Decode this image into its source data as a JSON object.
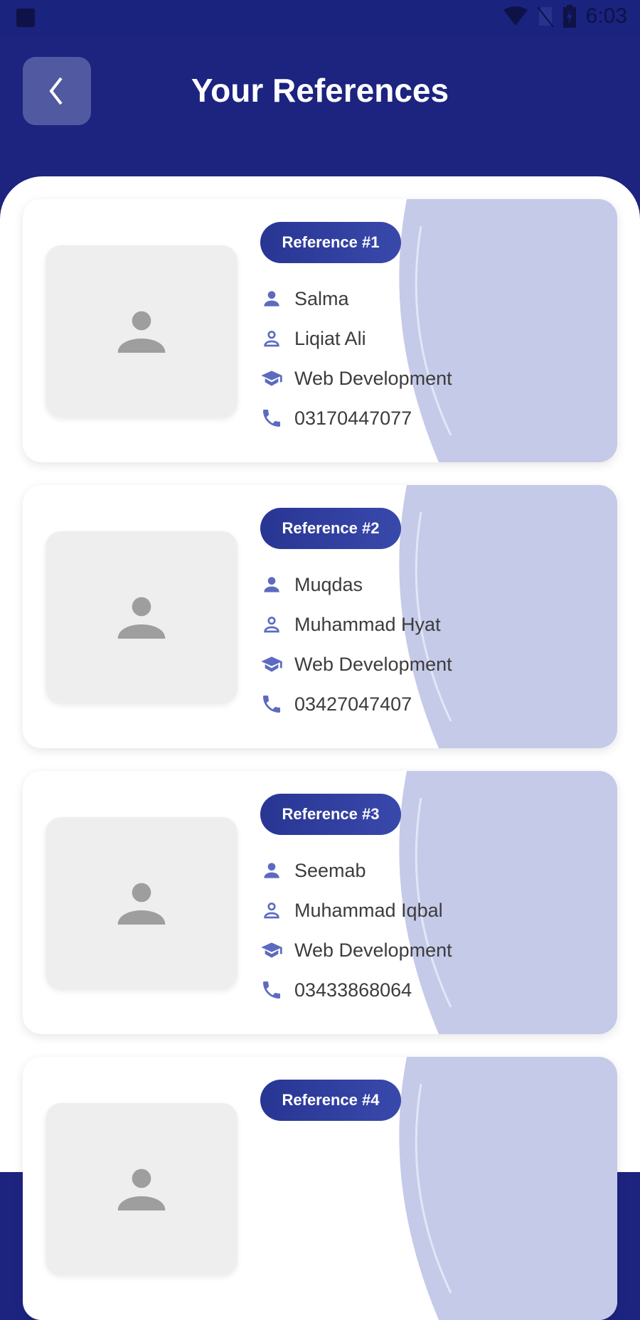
{
  "status_bar": {
    "time": "6:03",
    "icons": [
      "image-icon",
      "wifi-icon",
      "no-sim-icon",
      "battery-charging-icon"
    ]
  },
  "header": {
    "title": "Your References",
    "back_icon": "chevron-left-icon"
  },
  "colors": {
    "header": "#1c2480",
    "accent": "#3949ab",
    "icon": "#5c6bc0",
    "decor": "#c5cae9"
  },
  "references": [
    {
      "badge": "Reference #1",
      "name": "Salma",
      "father": "Liqiat Ali",
      "course": "Web Development",
      "phone": "03170447077"
    },
    {
      "badge": "Reference #2",
      "name": "Muqdas",
      "father": "Muhammad Hyat",
      "course": "Web Development",
      "phone": "03427047407"
    },
    {
      "badge": "Reference #3",
      "name": "Seemab",
      "father": "Muhammad Iqbal",
      "course": "Web Development",
      "phone": "03433868064"
    },
    {
      "badge": "Reference #4"
    }
  ]
}
